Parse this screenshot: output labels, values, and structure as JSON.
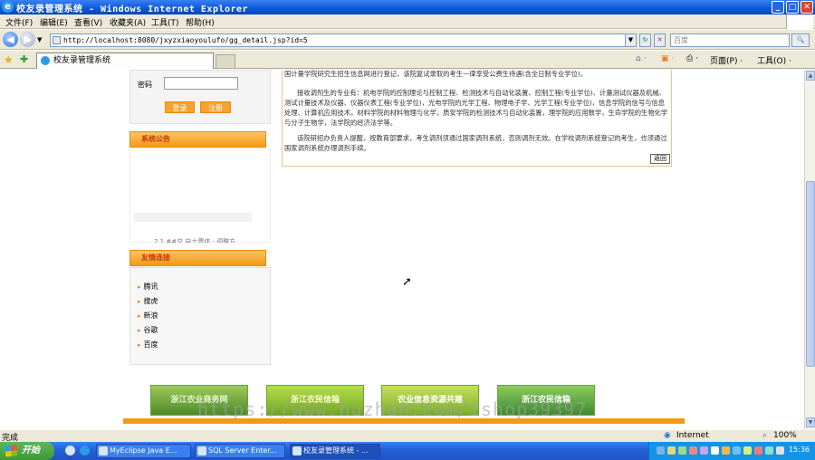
{
  "window": {
    "title": "校友录管理系统 - Windows Internet Explorer",
    "min": "_",
    "max": "□",
    "close": "✕"
  },
  "menu": [
    "文件(F)",
    "编辑(E)",
    "查看(V)",
    "收藏夹(A)",
    "工具(T)",
    "帮助(H)"
  ],
  "address": {
    "url": "http://localhost:8080/jxyzxiaoyoulufo/gg_detail.jsp?id=5",
    "search_placeholder": "百度"
  },
  "tab": {
    "title": "校友录管理系统",
    "commands": {
      "page": "页面(P) ·",
      "tools": "工具(O) ·"
    }
  },
  "sidebar": {
    "password_label": "密码",
    "login_button": "登录",
    "register_button": "注册",
    "notice_header": "系统公告",
    "notice_scrolling": "2 1 ##交 自士票体 · 调整方",
    "links_header": "友情连接",
    "links": [
      "腾讯",
      "搜虎",
      "新浪",
      "谷歌",
      "百度"
    ]
  },
  "article": {
    "top_line": "国计量学院研究生招生信息网进行登记，该院复试录取的考生一律享受公费生待遇(含全日制专业学位)。",
    "para2": "接收调剂生的专业有：机电学院的控制理论与控制工程、检测技术与自动化装置、控制工程(专业学位)、计量测试仪器及机械、测试计量技术及仪器、仪器仪表工程(专业学位)，光电学院的光学工程、物理电子学、光学工程(专业学位)，信息学院的信号与信息处理、计算机应用技术，材料学院的材料物理与化学，质安学院的检测技术与自动化装置，理学院的应用数学，生命学院的生物化学与分子生物学，法学院的经济法学等。",
    "para3": "该院研招办负责人提醒，按教育部要求，考生调剂须通过国家调剂系统，否则调剂无效。在学校调剂系统登记的考生，也须通过国家调剂系统办理调剂手续。",
    "back_button": "返回"
  },
  "banners": [
    "浙江农业商务网",
    "浙江农民信箱",
    "农业信息资源共建",
    "浙江农民信箱"
  ],
  "watermark": "https://www.huzhan.com/ishop39397",
  "status": {
    "left": "完成",
    "zone": "Internet",
    "zoom": "100%"
  },
  "taskbar": {
    "start": "开始",
    "tasks": [
      "MyEclipse Java E...",
      "SQL Server Enter...",
      "校友录管理系统 - ..."
    ],
    "clock": "15:36"
  },
  "colors": {
    "accent_orange": "#f39a14",
    "header_text": "#c6370b",
    "xp_blue": "#2462d8"
  }
}
